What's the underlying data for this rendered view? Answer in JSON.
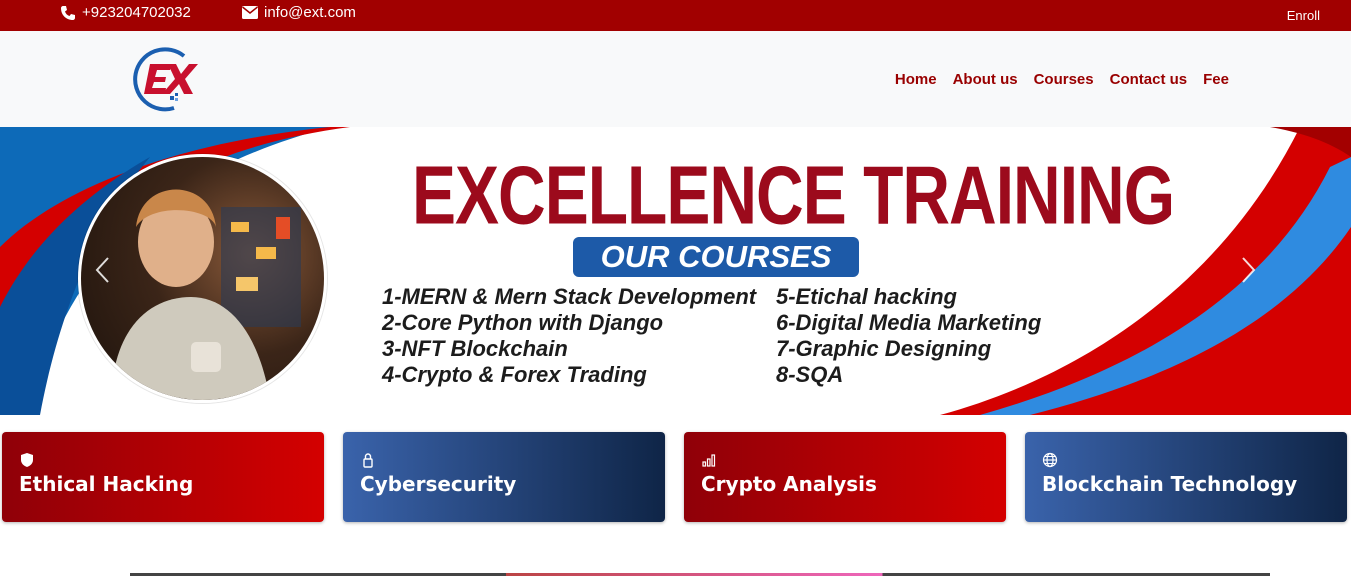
{
  "topbar": {
    "phone": "+923204702032",
    "email": "info@ext.com",
    "enroll": "Enroll"
  },
  "nav": {
    "items": [
      "Home",
      "About us",
      "Courses",
      "Contact us",
      "Fee"
    ]
  },
  "banner": {
    "title": "EXCELLENCE TRAINING",
    "subtitle": "OUR COURSES",
    "courses_left": [
      "1-MERN & Mern Stack Development",
      "2-Core Python with Django",
      "3-NFT Blockchain",
      "4-Crypto & Forex Trading"
    ],
    "courses_right": [
      "5-Etichal hacking",
      "6-Digital Media Marketing",
      "7-Graphic Designing",
      "8-SQA"
    ],
    "prev_label": "‹",
    "next_label": "›"
  },
  "cards": [
    {
      "title": "Ethical Hacking",
      "icon": "shield-icon"
    },
    {
      "title": "Cybersecurity",
      "icon": "lock-icon"
    },
    {
      "title": "Crypto Analysis",
      "icon": "chart-icon"
    },
    {
      "title": "Blockchain Technology",
      "icon": "globe-icon"
    }
  ],
  "colors": {
    "brand_red": "#a10000",
    "nav_text": "#990000",
    "banner_blue": "#1d5aa8",
    "card_blue_dark": "#0f2547"
  }
}
